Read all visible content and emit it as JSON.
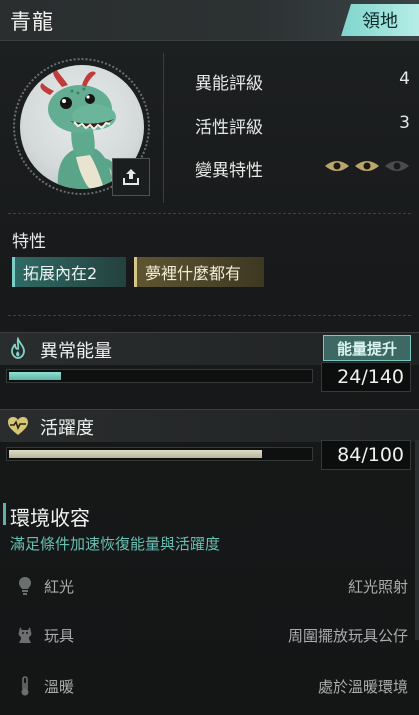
{
  "header": {
    "title": "青龍",
    "territory_tab": "領地"
  },
  "stats": [
    {
      "label": "異能評級",
      "value": "4"
    },
    {
      "label": "活性評級",
      "value": "3"
    },
    {
      "label": "變異特性",
      "icon": "eye-icons",
      "active_count": 2,
      "total": 3
    }
  ],
  "traits": {
    "heading": "特性",
    "chips": [
      "拓展內在2",
      "夢裡什麼都有"
    ]
  },
  "energy": {
    "label": "異常能量",
    "button": "能量提升",
    "value_text": "24/140",
    "current": 24,
    "max": 140,
    "icon": "flame-icon",
    "color": "#7fd5c8"
  },
  "vitality": {
    "label": "活躍度",
    "value_text": "84/100",
    "current": 84,
    "max": 100,
    "icon": "heart-pulse-icon",
    "color": "#d8d4b7"
  },
  "environment": {
    "heading": "環境收容",
    "subtitle": "滿足條件加速恢復能量與活躍度",
    "rows": [
      {
        "name": "紅光",
        "condition": "紅光照射",
        "icon": "lightbulb-icon"
      },
      {
        "name": "玩具",
        "condition": "周圍擺放玩具公仔",
        "icon": "toy-icon"
      },
      {
        "name": "溫暖",
        "condition": "處於溫暖環境",
        "icon": "thermometer-icon"
      }
    ]
  },
  "colors": {
    "accent_teal": "#7fd5cd",
    "accent_gold": "#d6c68a",
    "background": "#17191a"
  }
}
